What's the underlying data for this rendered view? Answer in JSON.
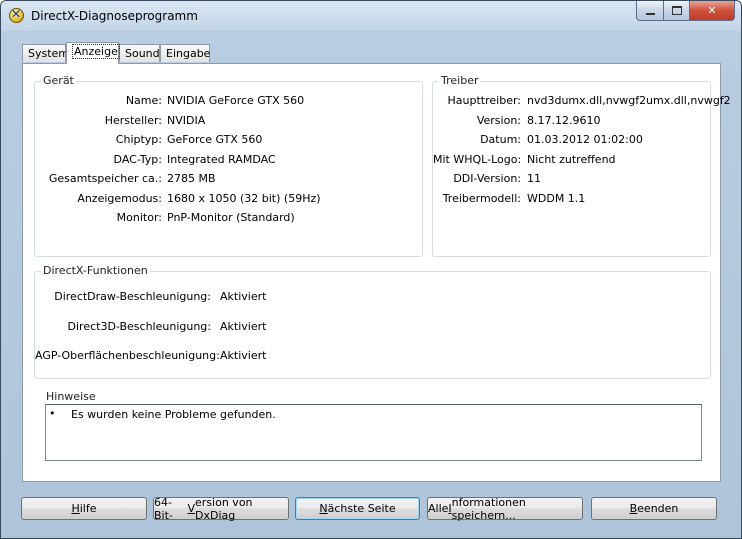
{
  "window": {
    "title": "DirectX-Diagnoseprogramm"
  },
  "tabs": [
    {
      "label": "System"
    },
    {
      "label": "Anzeige"
    },
    {
      "label": "Sound"
    },
    {
      "label": "Eingabe"
    }
  ],
  "geraet": {
    "heading": "Gerät",
    "rows": [
      {
        "label": "Name:",
        "value": "NVIDIA GeForce GTX 560"
      },
      {
        "label": "Hersteller:",
        "value": "NVIDIA"
      },
      {
        "label": "Chiptyp:",
        "value": "GeForce GTX 560"
      },
      {
        "label": "DAC-Typ:",
        "value": "Integrated RAMDAC"
      },
      {
        "label": "Gesamtspeicher ca.:",
        "value": "2785 MB"
      },
      {
        "label": "Anzeigemodus:",
        "value": "1680 x 1050 (32 bit) (59Hz)"
      },
      {
        "label": "Monitor:",
        "value": "PnP-Monitor (Standard)"
      }
    ]
  },
  "treiber": {
    "heading": "Treiber",
    "rows": [
      {
        "label": "Haupttreiber:",
        "value": "nvd3dumx.dll,nvwgf2umx.dll,nvwgf2"
      },
      {
        "label": "Version:",
        "value": "8.17.12.9610"
      },
      {
        "label": "Datum:",
        "value": "01.03.2012 01:02:00"
      },
      {
        "label": "Mit WHQL-Logo:",
        "value": "Nicht zutreffend"
      },
      {
        "label": "DDI-Version:",
        "value": "11"
      },
      {
        "label": "Treibermodell:",
        "value": "WDDM 1.1"
      }
    ]
  },
  "directx": {
    "heading": "DirectX-Funktionen",
    "rows": [
      {
        "label": "DirectDraw-Beschleunigung:",
        "value": "Aktiviert"
      },
      {
        "label": "Direct3D-Beschleunigung:",
        "value": "Aktiviert"
      },
      {
        "label": "AGP-Oberflächenbeschleunigung:",
        "value": "Aktiviert"
      }
    ]
  },
  "hinweise": {
    "heading": "Hinweise",
    "items": [
      "Es wurden keine Probleme gefunden."
    ]
  },
  "buttons": {
    "hilfe": {
      "first": "H",
      "rest": "ilfe"
    },
    "bit64": {
      "pre": "64-Bit-",
      "u": "V",
      "post": "ersion von DxDiag"
    },
    "naechste": {
      "u": "N",
      "rest": "ächste Seite"
    },
    "alle": {
      "pre": "Alle ",
      "u": "I",
      "post": "nformationen speichern..."
    },
    "beenden": {
      "u": "B",
      "rest": "eenden"
    }
  }
}
